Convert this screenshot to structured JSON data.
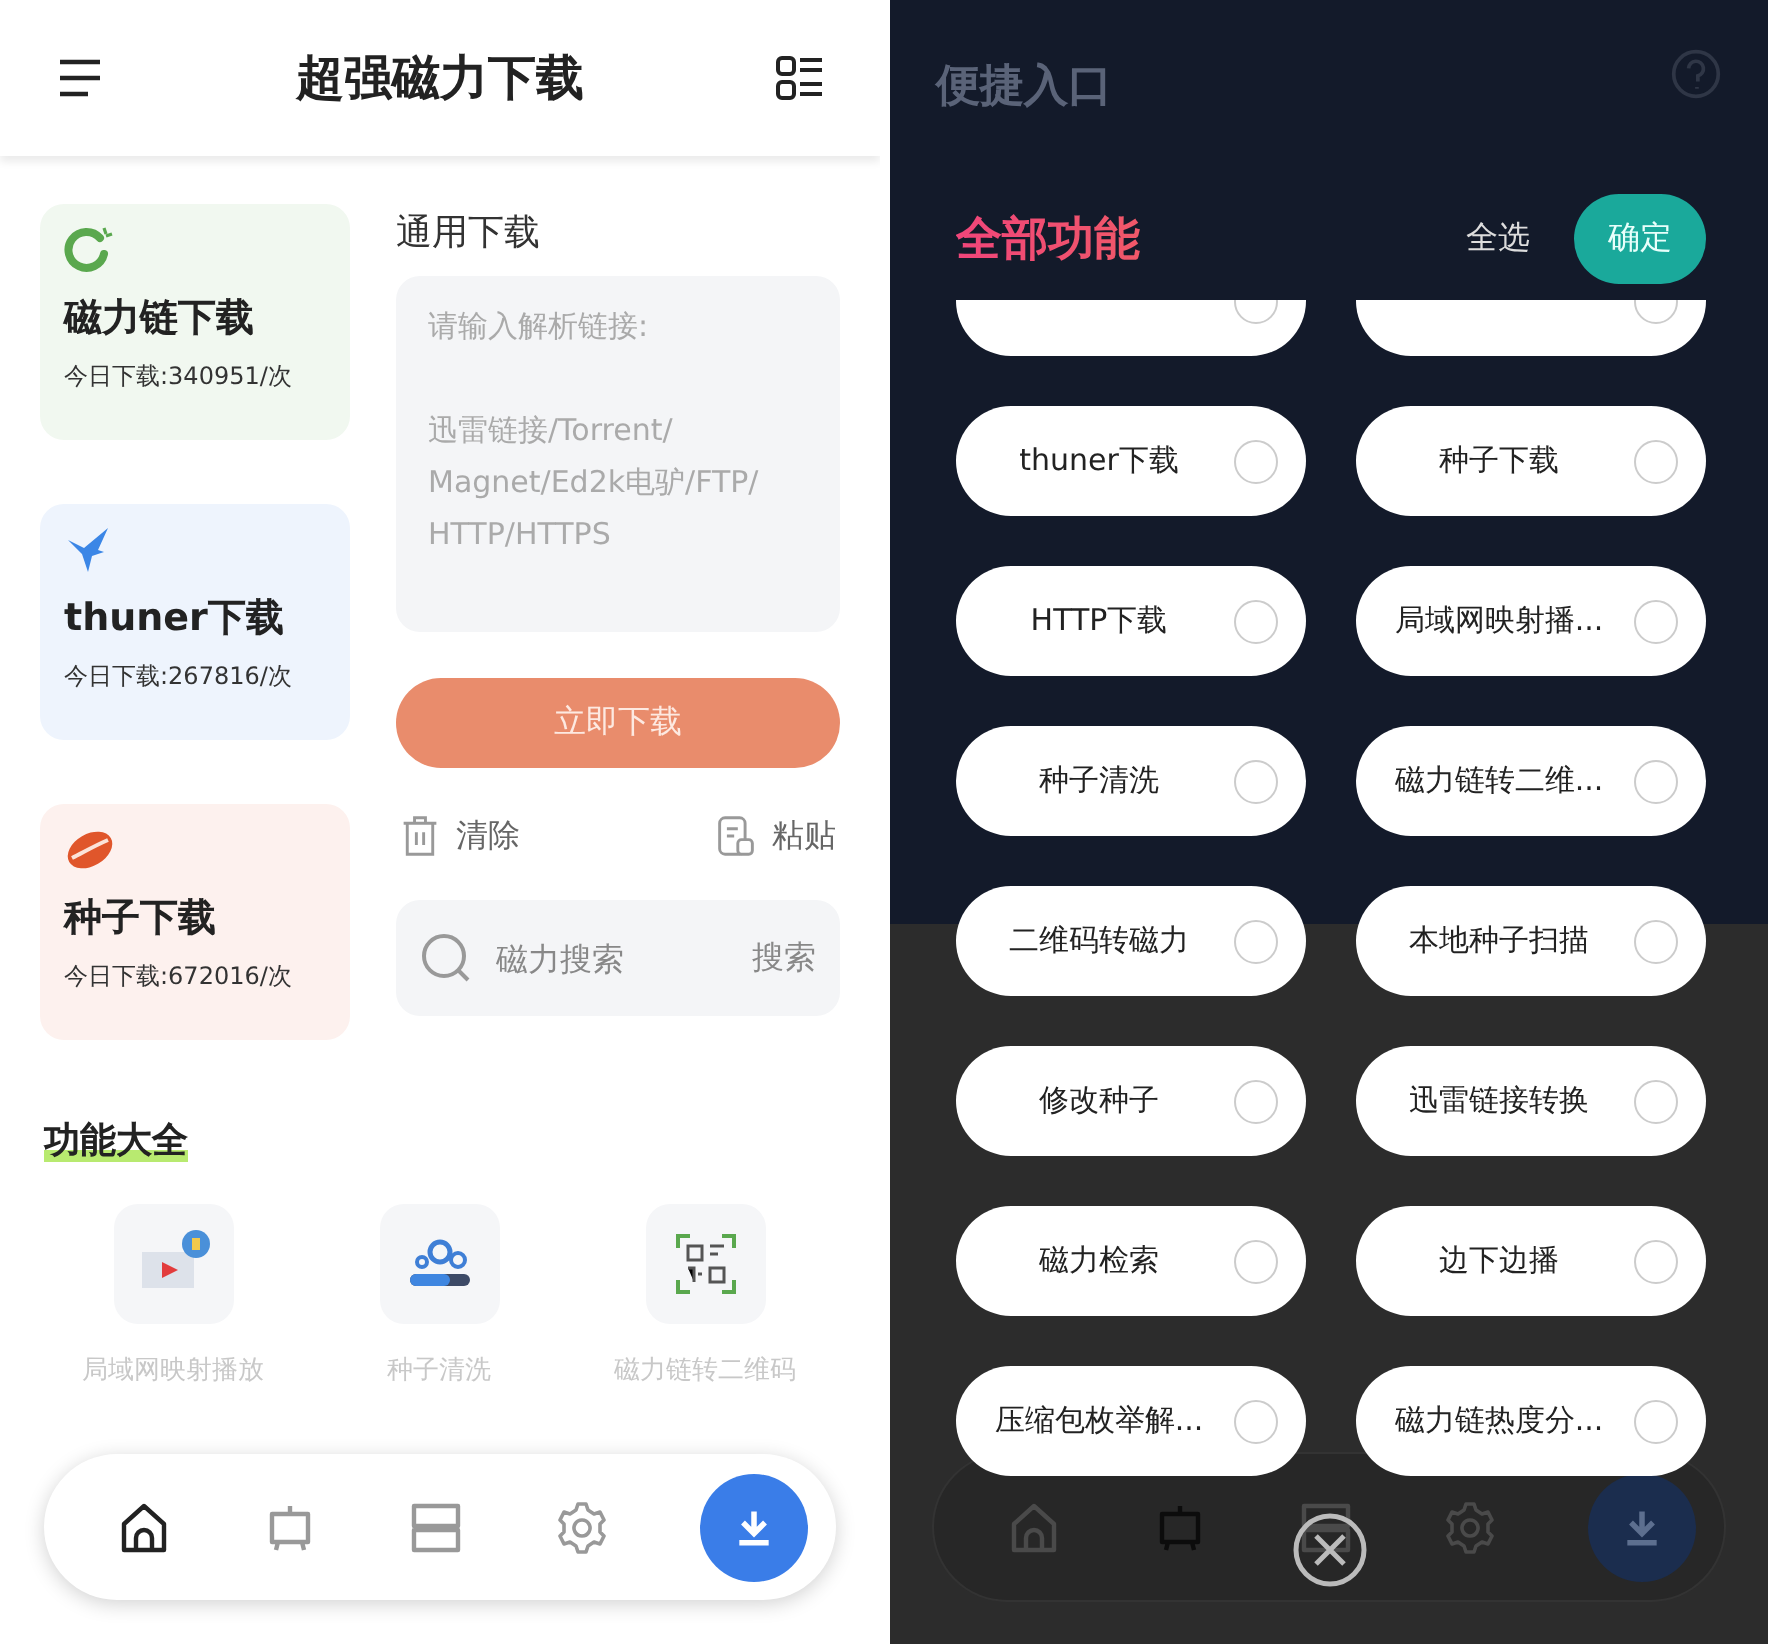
{
  "home": {
    "title": "超强磁力下载",
    "cards": [
      {
        "kind": "magnet",
        "title": "磁力链下载",
        "count": "今日下载:340951/次",
        "color": "#f1f8f0"
      },
      {
        "kind": "bird",
        "title": "thuner下载",
        "count": "今日下载:267816/次",
        "color": "#eef4fd"
      },
      {
        "kind": "seed",
        "title": "种子下载",
        "count": "今日下载:672016/次",
        "color": "#fdf1ee"
      }
    ],
    "general": {
      "label": "通用下载",
      "placeholder": "请输入解析链接:\n\n迅雷链接/Torrent/\nMagnet/Ed2k电驴/FTP/\nHTTP/HTTPS",
      "button": "立即下载"
    },
    "actions": [
      {
        "kind": "clear",
        "label": "清除"
      },
      {
        "kind": "paste",
        "label": "粘贴"
      }
    ],
    "search": {
      "placeholder": "磁力搜索",
      "button": "搜索"
    },
    "section_title": "功能大全",
    "features": [
      {
        "kind": "cast",
        "label": "局域网映射播放"
      },
      {
        "kind": "gears",
        "label": "种子清洗"
      },
      {
        "kind": "qr",
        "label": "磁力链转二维码"
      }
    ],
    "nav": [
      {
        "kind": "home",
        "selected": true
      },
      {
        "kind": "tv",
        "selected": false
      },
      {
        "kind": "cards",
        "selected": false
      },
      {
        "kind": "gear",
        "selected": false
      },
      {
        "kind": "download",
        "selected": false
      }
    ]
  },
  "picker": {
    "background_title": "便捷入口",
    "title": "全部功能",
    "select_all": "全选",
    "confirm": "确定",
    "options": [
      {
        "label": "thuner下载",
        "checked": false
      },
      {
        "label": "种子下载",
        "checked": false
      },
      {
        "label": "HTTP下载",
        "checked": false
      },
      {
        "label": "局域网映射播...",
        "checked": false
      },
      {
        "label": "种子清洗",
        "checked": false
      },
      {
        "label": "磁力链转二维...",
        "checked": false
      },
      {
        "label": "二维码转磁力",
        "checked": false
      },
      {
        "label": "本地种子扫描",
        "checked": false
      },
      {
        "label": "修改种子",
        "checked": false
      },
      {
        "label": "迅雷链接转换",
        "checked": false
      },
      {
        "label": "磁力检索",
        "checked": false
      },
      {
        "label": "边下边播",
        "checked": false
      },
      {
        "label": "压缩包枚举解...",
        "checked": false
      },
      {
        "label": "磁力链热度分...",
        "checked": false
      }
    ],
    "nav": [
      {
        "kind": "home",
        "selected": false
      },
      {
        "kind": "tv",
        "selected": true
      },
      {
        "kind": "cards",
        "selected": false
      },
      {
        "kind": "gear",
        "selected": false
      },
      {
        "kind": "download",
        "selected": false
      }
    ]
  }
}
